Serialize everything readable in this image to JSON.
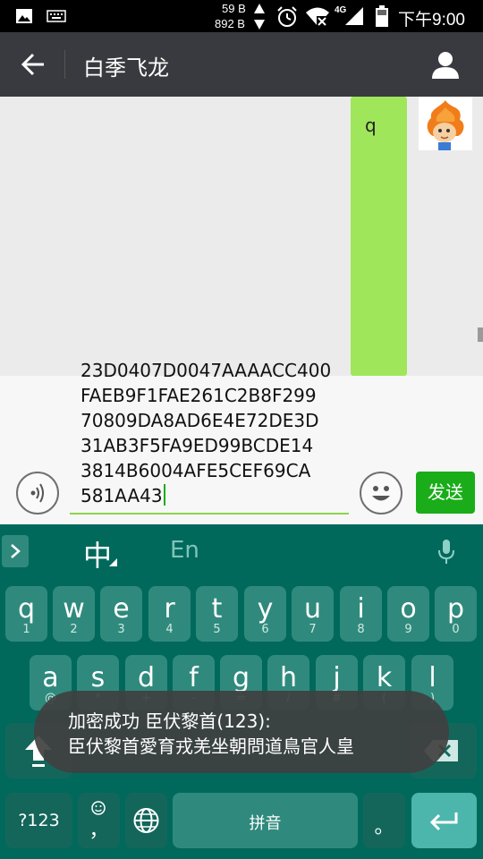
{
  "status_bar": {
    "net_up": "59 B",
    "net_down": "892 B",
    "signal_type": "4G",
    "time": "下午9:00"
  },
  "header": {
    "title": "白季飞龙"
  },
  "chat": {
    "messages": [
      {
        "text": "q",
        "sender": "self"
      }
    ]
  },
  "composer": {
    "lines": [
      "23D0407D0047AAAACC400",
      "FAEB9F1FAE261C2B8F299",
      "70809DA8AD6E4E72DE3D",
      "31AB3F5FA9ED99BCDE14",
      "3814B6004AFE5CEF69CA",
      "581AA43"
    ],
    "send_label": "发送"
  },
  "keyboard": {
    "mode_chinese": "中",
    "mode_english": "En",
    "row1": [
      {
        "main": "q",
        "sub": "1"
      },
      {
        "main": "w",
        "sub": "2"
      },
      {
        "main": "e",
        "sub": "3"
      },
      {
        "main": "r",
        "sub": "4"
      },
      {
        "main": "t",
        "sub": "5"
      },
      {
        "main": "y",
        "sub": "6"
      },
      {
        "main": "u",
        "sub": "7"
      },
      {
        "main": "i",
        "sub": "8"
      },
      {
        "main": "o",
        "sub": "9"
      },
      {
        "main": "p",
        "sub": "0"
      }
    ],
    "row2": [
      {
        "main": "a",
        "sub": "@"
      },
      {
        "main": "s",
        "sub": "*"
      },
      {
        "main": "d",
        "sub": "+"
      },
      {
        "main": "f",
        "sub": "-"
      },
      {
        "main": "g",
        "sub": "="
      },
      {
        "main": "h",
        "sub": "/"
      },
      {
        "main": "j",
        "sub": "#"
      },
      {
        "main": "k",
        "sub": "("
      },
      {
        "main": "l",
        "sub": ")"
      }
    ],
    "symbols_label": "?123",
    "emoji_sub": "，",
    "space_label": "拼音",
    "period_label": "。"
  },
  "toast": {
    "line1": "加密成功 臣伏黎首(123):",
    "line2": "臣伏黎首愛育戎羌坐朝問道鳥官人皇"
  }
}
